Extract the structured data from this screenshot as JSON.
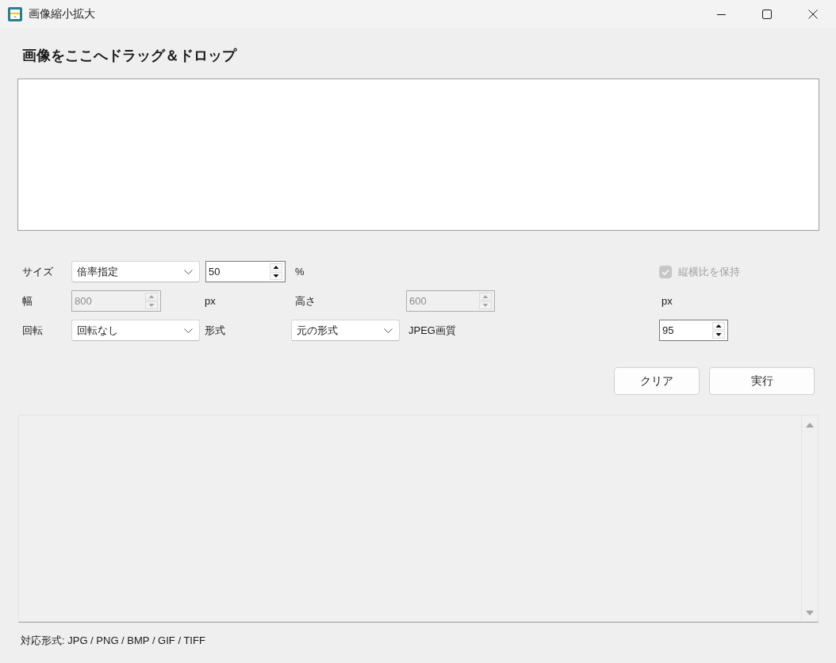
{
  "window": {
    "title": "画像縮小拡大"
  },
  "drop_area": {
    "heading": "画像をここへドラッグ＆ドロップ"
  },
  "form": {
    "size": {
      "label": "サイズ",
      "mode": "倍率指定",
      "value": "50",
      "disabled": false,
      "unit": "%"
    },
    "keep_aspect": {
      "label": "縦横比を保持",
      "checked": true,
      "disabled": true
    },
    "width": {
      "label": "幅",
      "value": "800",
      "disabled": true,
      "unit": "px"
    },
    "height": {
      "label": "高さ",
      "value": "600",
      "disabled": true,
      "unit": "px"
    },
    "rotation": {
      "label": "回転",
      "value": "回転なし"
    },
    "format": {
      "label": "形式",
      "value": "元の形式"
    },
    "jpeg_quality": {
      "label": "JPEG画質",
      "value": "95",
      "disabled": false
    }
  },
  "buttons": [
    {
      "label": "クリア"
    },
    {
      "label": "実行"
    }
  ],
  "status_bar": {
    "text": "対応形式: JPG / PNG / BMP / GIF / TIFF"
  }
}
